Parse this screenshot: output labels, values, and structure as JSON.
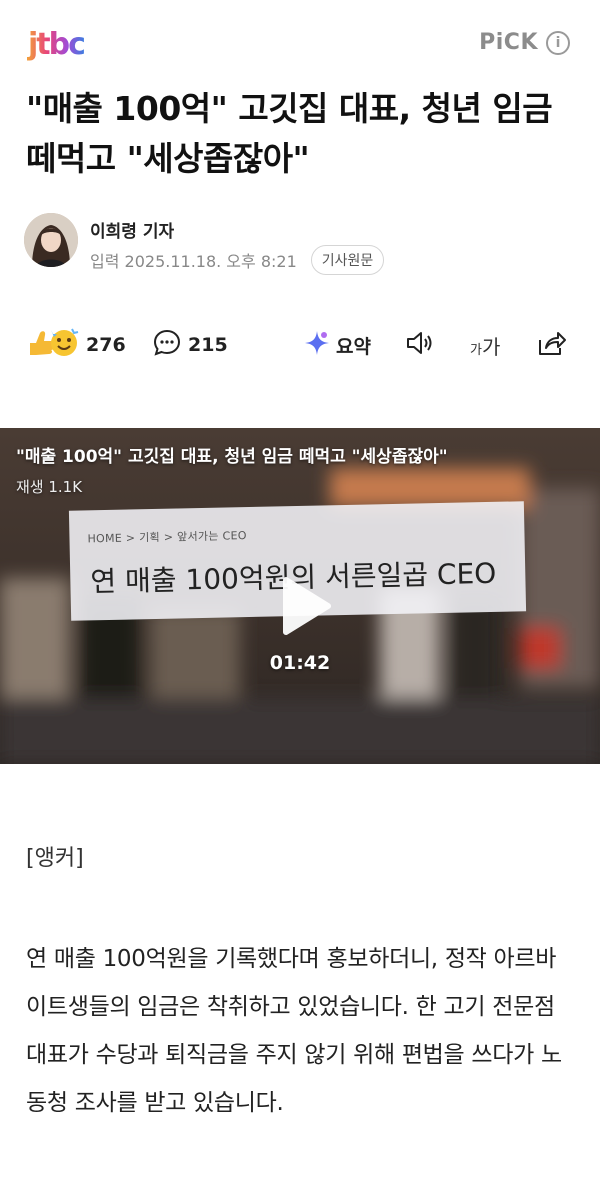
{
  "header": {
    "logo_text": "jtbc",
    "pick_label": "PiCK",
    "info_icon": "info-icon"
  },
  "article": {
    "headline": "\"매출 100억\" 고깃집 대표, 청년 임금 떼먹고 \"세상좁잖아\"",
    "reporter": "이희령 기자",
    "date": "입력 2025.11.18. 오후 8:21",
    "original_button": "기사원문"
  },
  "actions": {
    "reactions_count": "276",
    "comments_count": "215",
    "summary_label": "요약",
    "font_small": "가",
    "font_large": "가"
  },
  "video": {
    "title": "\"매출 100억\" 고깃집 대표, 청년 임금 떼먹고 \"세상좁잖아\"",
    "views": "재생 1.1K",
    "breadcrumb": "HOME  >  기획  >  앞서가는 CEO",
    "card_title": "연 매출 100억원의 서른일곱 CEO",
    "duration": "01:42"
  },
  "body": {
    "anchor": "[앵커]",
    "paragraph": "연 매출 100억원을 기록했다며 홍보하더니, 정작 아르바이트생들의 임금은 착취하고 있었습니다. 한 고기 전문점 대표가 수당과 퇴직금을 주지 않기 위해 편법을 쓰다가 노동청 조사를 받고 있습니다."
  },
  "colors": {
    "accent_summary": "#4a6cf7",
    "muted_text": "#888888"
  }
}
